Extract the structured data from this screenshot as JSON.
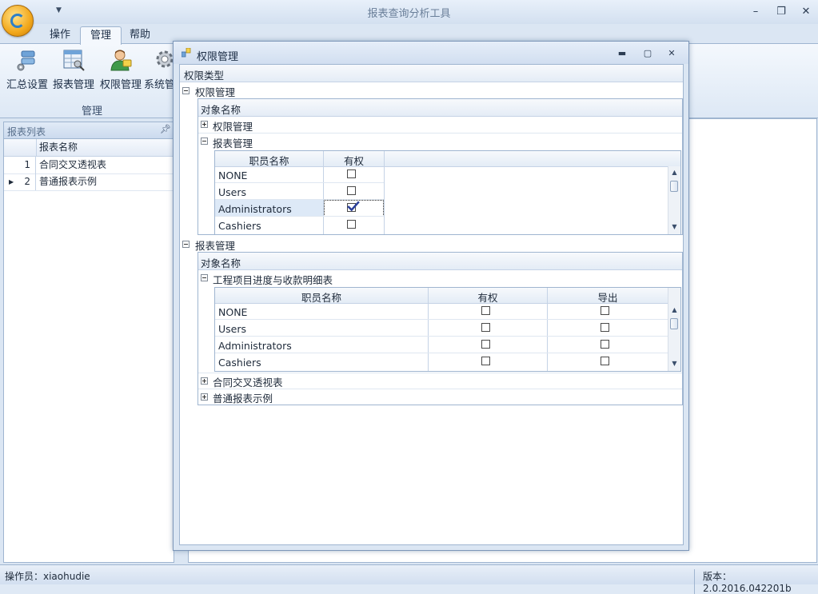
{
  "app": {
    "title": "报表查询分析工具",
    "tabs": [
      "操作",
      "管理",
      "帮助"
    ],
    "active_tab": "管理"
  },
  "ribbon": {
    "buttons": [
      {
        "label": "汇总设置",
        "icon": "summary-settings-icon"
      },
      {
        "label": "报表管理",
        "icon": "report-management-icon"
      },
      {
        "label": "权限管理",
        "icon": "permission-management-icon"
      },
      {
        "label": "系统管",
        "icon": "system-gear-icon"
      }
    ],
    "group_label": "管理"
  },
  "left_panel": {
    "title": "报表列表",
    "column_header": "报表名称",
    "rows": [
      {
        "num": "1",
        "name": "合同交叉透视表",
        "current": false
      },
      {
        "num": "2",
        "name": "普通报表示例",
        "current": true
      }
    ]
  },
  "status": {
    "user": "操作员：xiaohudie",
    "version": "版本：2.0.2016.042201b"
  },
  "dialog": {
    "title": "权限管理",
    "column_header": "权限类型",
    "sections": [
      {
        "label": "权限管理",
        "object_header": "对象名称",
        "items": [
          {
            "label": "权限管理",
            "expanded": false
          },
          {
            "label": "报表管理",
            "expanded": true,
            "grid": {
              "headers": [
                "职员名称",
                "有权"
              ],
              "rows": [
                {
                  "name": "NONE",
                  "checks": [
                    false
                  ]
                },
                {
                  "name": "Users",
                  "checks": [
                    false
                  ]
                },
                {
                  "name": "Administrators",
                  "checks": [
                    true
                  ],
                  "selected": true
                },
                {
                  "name": "Cashiers",
                  "checks": [
                    false
                  ]
                }
              ]
            }
          }
        ]
      },
      {
        "label": "报表管理",
        "object_header": "对象名称",
        "items": [
          {
            "label": "工程项目进度与收款明细表",
            "expanded": true,
            "grid": {
              "headers": [
                "职员名称",
                "有权",
                "导出"
              ],
              "rows": [
                {
                  "name": "NONE",
                  "checks": [
                    false,
                    false
                  ]
                },
                {
                  "name": "Users",
                  "checks": [
                    false,
                    false
                  ]
                },
                {
                  "name": "Administrators",
                  "checks": [
                    false,
                    false
                  ]
                },
                {
                  "name": "Cashiers",
                  "checks": [
                    false,
                    false
                  ]
                }
              ]
            }
          },
          {
            "label": "合同交叉透视表",
            "expanded": false
          },
          {
            "label": "普通报表示例",
            "expanded": false
          }
        ]
      }
    ]
  }
}
